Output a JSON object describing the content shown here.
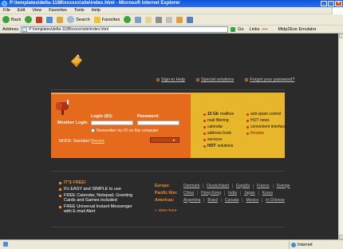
{
  "window": {
    "title": "P:\\templates\\delta-1188\\xxxxxx\\site\\index.html - Microsoft Internet Explorer"
  },
  "menu": [
    "File",
    "Edit",
    "View",
    "Favorites",
    "Tools",
    "Help"
  ],
  "toolbar": {
    "back": "Back",
    "search": "Search",
    "favorites": "Favorites"
  },
  "address": {
    "label": "Address",
    "value": "P:\\templates\\delta-1188\\xxxxx\\site\\index.html",
    "go": "Go",
    "links": "Links",
    "emulator": "Midp2Exe Emulator"
  },
  "top_links": [
    "Sign-in Help",
    "Special solutions",
    "Forgot your password?"
  ],
  "login": {
    "title": "Member Login",
    "id_label": "Login (ID):",
    "pw_label": "Password:",
    "remember": "Remember my ID on this computer",
    "mode_prefix": "MODE: Standard |",
    "mode_link": "Secure"
  },
  "features_left": [
    {
      "bold": "15 Gb",
      "text": "mailbox"
    },
    {
      "bold": "",
      "text": "mail filtering"
    },
    {
      "bold": "",
      "text": "calendar"
    },
    {
      "bold": "",
      "text": "address book"
    },
    {
      "bold": "",
      "text": "services"
    },
    {
      "bold": "HOT",
      "text": "solutions"
    }
  ],
  "features_right": [
    {
      "text": "anti-spam control",
      "hi": false
    },
    {
      "text": "HOT news",
      "hi": false
    },
    {
      "text": "convenient interface",
      "hi": false
    },
    {
      "text": "forums",
      "hi": true
    }
  ],
  "bullets": [
    "IT'S FREE!",
    "It's EASY and SIMPLE to use",
    "FREE Calendar, Notepad, Greeting Cards and Games included",
    "FREE Universal Instant Messenger with E-mail Alert"
  ],
  "regions": [
    {
      "name": "Europe:",
      "countries": [
        "Danmark",
        "Deutschland",
        "España",
        "France",
        "Sverige"
      ]
    },
    {
      "name": "Pacific Rim:",
      "countries": [
        "China",
        "Hong Kong",
        "India",
        "Japan",
        "Korea"
      ]
    },
    {
      "name": "Americas:",
      "countries": [
        "Argentina",
        "Brasil",
        "Canada",
        "Mexico",
        "in Chinese"
      ]
    }
  ],
  "view_more": "view more",
  "status": {
    "zone": "Internet"
  },
  "colors": {
    "accent_orange": "#e66a1c",
    "accent_yellow": "#e7b62a",
    "background": "#2b2b2b"
  }
}
